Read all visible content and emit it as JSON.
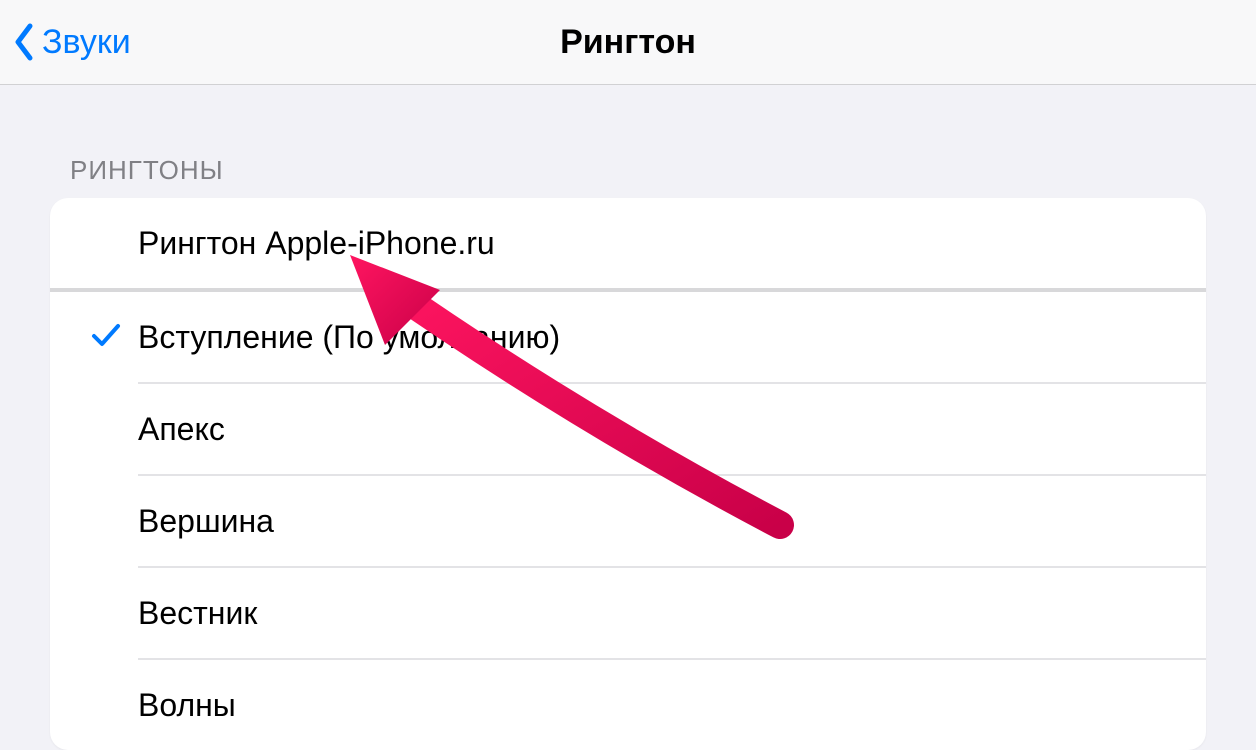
{
  "nav": {
    "back_label": "Звуки",
    "title": "Рингтон"
  },
  "section_header": "РИНГТОНЫ",
  "ringtones": {
    "custom": {
      "label": "Рингтон Apple-iPhone.ru",
      "selected": false
    },
    "builtin": [
      {
        "label": "Вступление (По умолчанию)",
        "selected": true
      },
      {
        "label": "Апекс",
        "selected": false
      },
      {
        "label": "Вершина",
        "selected": false
      },
      {
        "label": "Вестник",
        "selected": false
      },
      {
        "label": "Волны",
        "selected": false
      }
    ]
  },
  "colors": {
    "accent": "#007aff",
    "background": "#f2f2f7",
    "annotation": "#e91e63"
  }
}
